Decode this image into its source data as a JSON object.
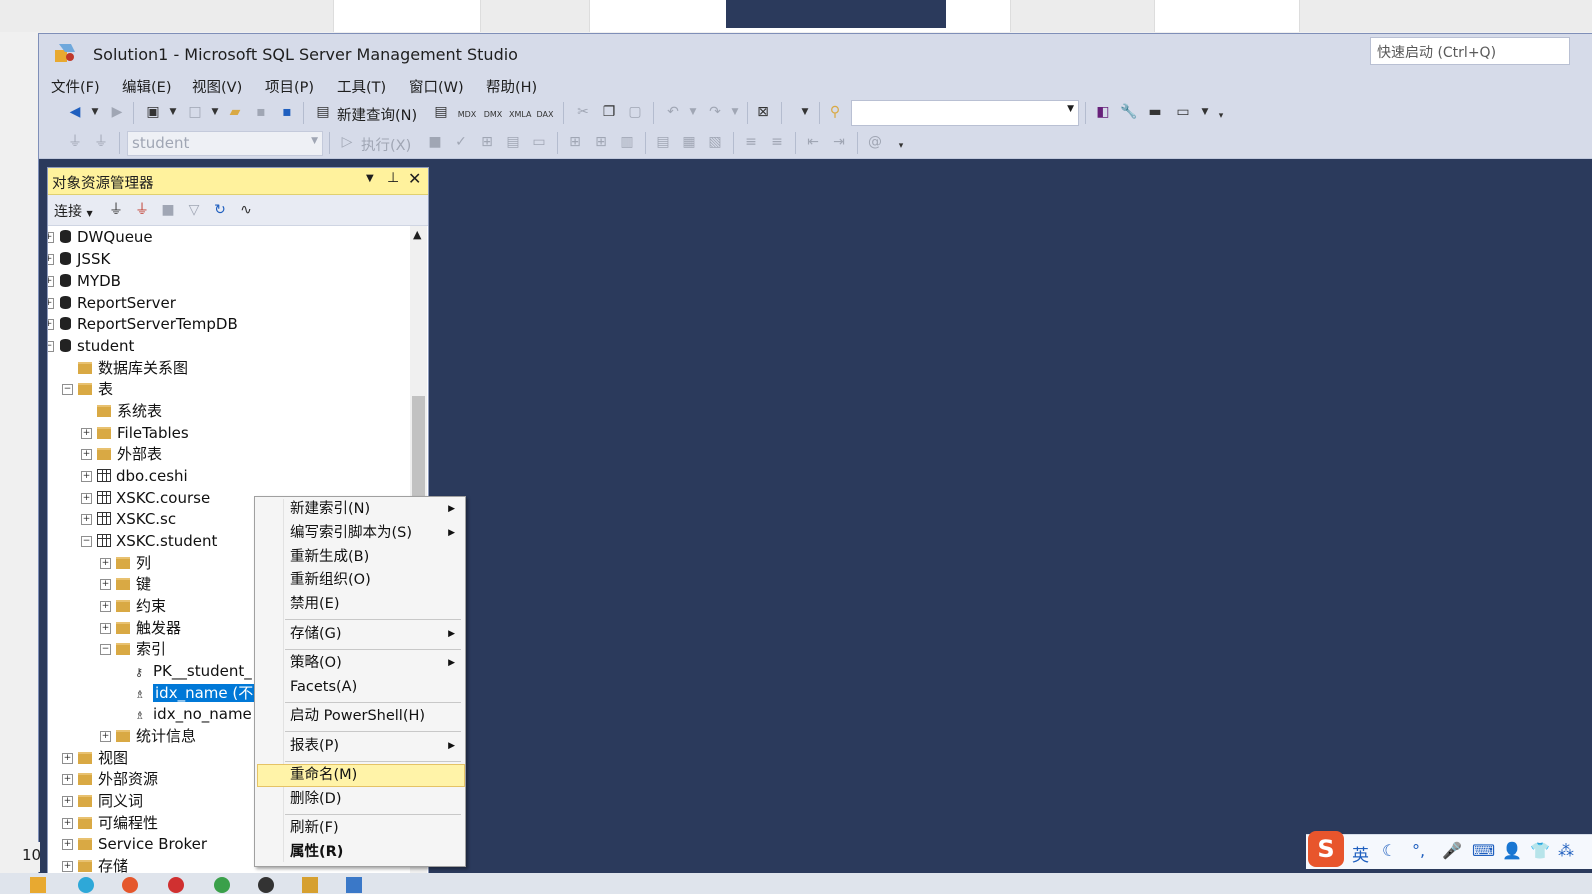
{
  "window": {
    "title": "Solution1 - Microsoft SQL Server Management Studio",
    "quick_launch_placeholder": "快速启动 (Ctrl+Q)"
  },
  "menubar": [
    "文件(F)",
    "编辑(E)",
    "视图(V)",
    "项目(P)",
    "工具(T)",
    "窗口(W)",
    "帮助(H)"
  ],
  "toolbar": {
    "new_query_label": "新建查询(N)",
    "database_selector": "student",
    "execute_label": "执行(X)",
    "icon_labels": [
      "MDX",
      "DMX",
      "XMLA",
      "DAX"
    ]
  },
  "object_explorer": {
    "title": "对象资源管理器",
    "connect_label": "连接",
    "tree": [
      {
        "label": "DWQueue",
        "type": "db"
      },
      {
        "label": "JSSK",
        "type": "db"
      },
      {
        "label": "MYDB",
        "type": "db"
      },
      {
        "label": "ReportServer",
        "type": "db"
      },
      {
        "label": "ReportServerTempDB",
        "type": "db"
      },
      {
        "label": "student",
        "type": "db"
      },
      {
        "label": "数据库关系图",
        "type": "folder"
      },
      {
        "label": "表",
        "type": "folder"
      },
      {
        "label": "系统表",
        "type": "folder"
      },
      {
        "label": "FileTables",
        "type": "folder"
      },
      {
        "label": "外部表",
        "type": "folder"
      },
      {
        "label": "dbo.ceshi",
        "type": "table"
      },
      {
        "label": "XSKC.course",
        "type": "table"
      },
      {
        "label": "XSKC.sc",
        "type": "table"
      },
      {
        "label": "XSKC.student",
        "type": "table"
      },
      {
        "label": "列",
        "type": "folder"
      },
      {
        "label": "键",
        "type": "folder"
      },
      {
        "label": "约束",
        "type": "folder"
      },
      {
        "label": "触发器",
        "type": "folder"
      },
      {
        "label": "索引",
        "type": "folder"
      },
      {
        "label": "PK__student_",
        "type": "key"
      },
      {
        "label": "idx_name (不唯",
        "type": "index"
      },
      {
        "label": "idx_no_name (",
        "type": "index"
      },
      {
        "label": "统计信息",
        "type": "folder"
      },
      {
        "label": "视图",
        "type": "folder"
      },
      {
        "label": "外部资源",
        "type": "folder"
      },
      {
        "label": "同义词",
        "type": "folder"
      },
      {
        "label": "可编程性",
        "type": "folder"
      },
      {
        "label": "Service Broker",
        "type": "folder"
      },
      {
        "label": "存储",
        "type": "folder"
      }
    ]
  },
  "context_menu": {
    "items": [
      {
        "label": "新建索引(N)",
        "submenu": true
      },
      {
        "label": "编写索引脚本为(S)",
        "submenu": true
      },
      {
        "label": "重新生成(B)",
        "submenu": false
      },
      {
        "label": "重新组织(O)",
        "submenu": false
      },
      {
        "label": "禁用(E)",
        "submenu": false
      },
      {
        "label": "存储(G)",
        "submenu": true
      },
      {
        "label": "策略(O)",
        "submenu": true
      },
      {
        "label": "Facets(A)",
        "submenu": false
      },
      {
        "label": "启动 PowerShell(H)",
        "submenu": false
      },
      {
        "label": "报表(P)",
        "submenu": true
      },
      {
        "label": "重命名(M)",
        "submenu": false
      },
      {
        "label": "删除(D)",
        "submenu": false
      },
      {
        "label": "刷新(F)",
        "submenu": false
      },
      {
        "label": "属性(R)",
        "submenu": false
      }
    ],
    "highlighted": "重命名(M)"
  },
  "ime": {
    "mode_label": "英"
  },
  "status_left": "10",
  "colors": {
    "accent": "#0078d7",
    "editor_bg": "#2b3a5c",
    "panel_header": "#fff29d",
    "chrome": "#d6dbe9"
  }
}
